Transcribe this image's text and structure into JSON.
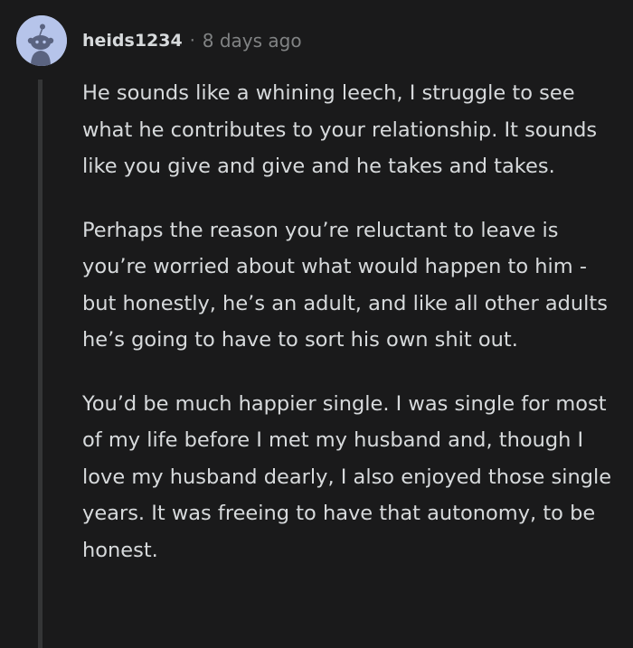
{
  "comment": {
    "username": "heids1234",
    "separator": "·",
    "timestamp": "8 days ago",
    "avatar_icon": "snoo-avatar-icon",
    "paragraphs": [
      "He sounds like a whining leech, I struggle to see what he contributes to your relationship. It sounds like you give and give and he takes and takes.",
      "Perhaps the reason you’re reluctant to leave is you’re worried about what would happen to him - but honestly, he’s an adult, and like all other adults he’s going to have to sort his own shit out.",
      "You’d be much happier single. I was single for most of my life before I met my husband and, though I love my husband dearly, I also enjoyed those single years. It was freeing to have that autonomy, to be honest."
    ]
  },
  "colors": {
    "background": "#1a1a1b",
    "text": "#d7dadc",
    "muted": "#818384",
    "thread_line": "#343536",
    "avatar_bg": "#b6c4ea"
  }
}
